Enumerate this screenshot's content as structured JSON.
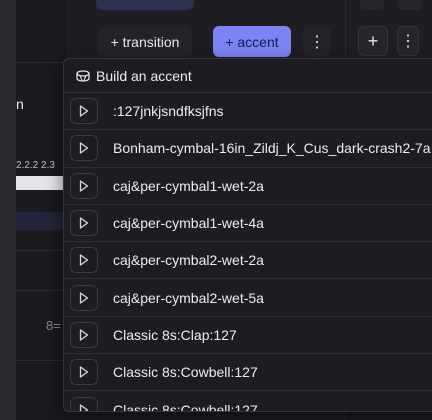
{
  "toolbar": {
    "transition_label": "+ transition",
    "accent_label": "+ accent",
    "kebab_glyph": "⋮",
    "plus_glyph": "+",
    "kebab2_glyph": "⋮"
  },
  "background": {
    "fragment_text": "n",
    "ruler_text": "2.2.2   2.3",
    "drag_glyph": "8="
  },
  "menu": {
    "header_label": "Build an accent",
    "header_icon": "drum-icon",
    "items": [
      {
        "label": ":127jnkjsndfksjfns"
      },
      {
        "label": "Bonham-cymbal-16in_Zildj_K_Cus_dark-crash2-7a"
      },
      {
        "label": "caj&per-cymbal1-wet-2a"
      },
      {
        "label": "caj&per-cymbal1-wet-4a"
      },
      {
        "label": "caj&per-cymbal2-wet-2a"
      },
      {
        "label": "caj&per-cymbal2-wet-5a"
      },
      {
        "label": "Classic 8s:Clap:127"
      },
      {
        "label": "Classic 8s:Cowbell:127"
      },
      {
        "label": "Classic 8s:Cowbell:127"
      }
    ]
  },
  "colors": {
    "accent": "#7b84f2",
    "panel": "#1c1c21",
    "background": "#2b2a30"
  }
}
